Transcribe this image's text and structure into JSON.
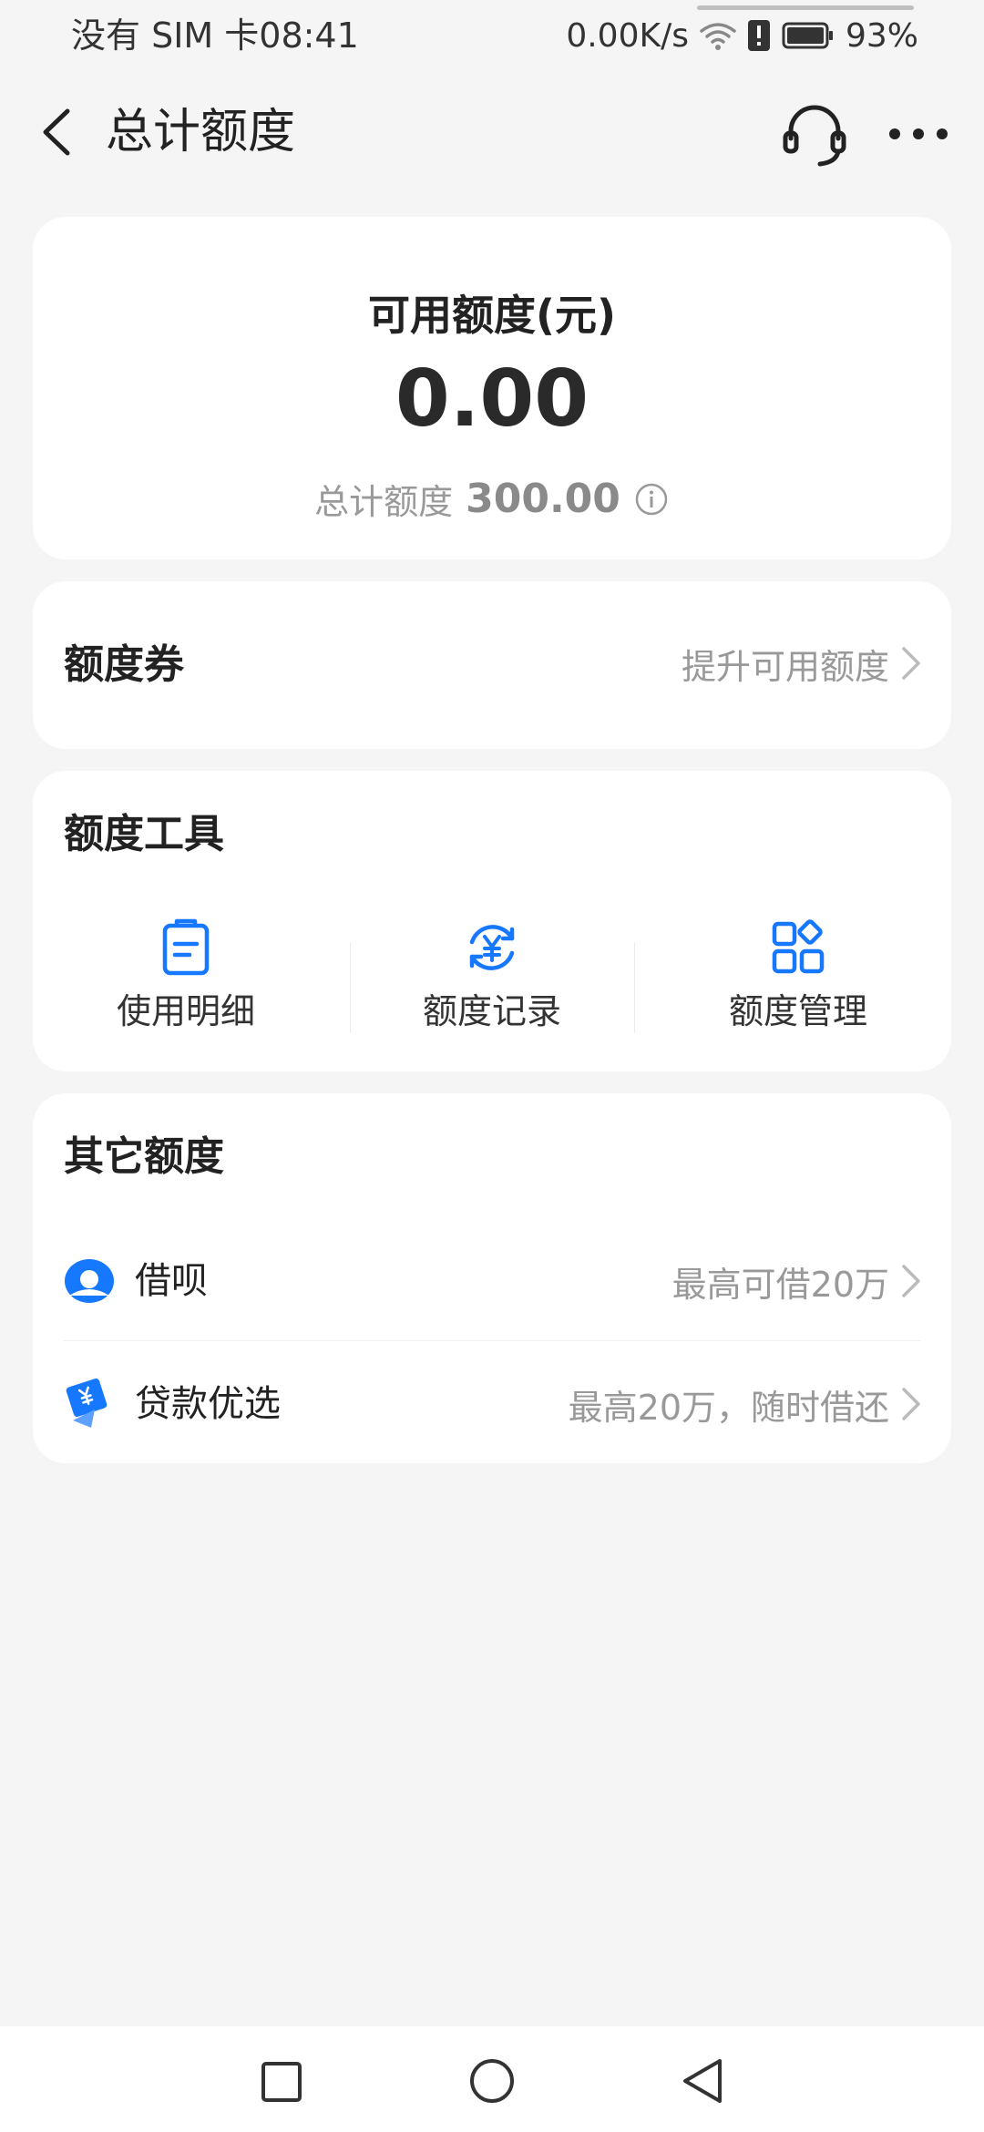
{
  "status_bar": {
    "carrier_time": "没有 SIM 卡08:41",
    "network_speed": "0.00K/s",
    "battery": "93%",
    "icons": [
      "wifi-icon",
      "alert-icon",
      "battery-icon"
    ]
  },
  "header": {
    "title": "总计额度",
    "icons": [
      "back-icon",
      "headset-icon",
      "more-icon"
    ]
  },
  "quota": {
    "label": "可用额度(元)",
    "available": "0.00",
    "total_label": "总计额度",
    "total_value": "300.00"
  },
  "coupon": {
    "title": "额度券",
    "action": "提升可用额度"
  },
  "tools": {
    "title": "额度工具",
    "items": [
      {
        "label": "使用明细",
        "icon": "document-icon"
      },
      {
        "label": "额度记录",
        "icon": "yuan-cycle-icon"
      },
      {
        "label": "额度管理",
        "icon": "grid-icon"
      }
    ]
  },
  "others": {
    "title": "其它额度",
    "items": [
      {
        "label": "借呗",
        "desc": "最高可借20万",
        "icon": "jiebei-icon"
      },
      {
        "label": "贷款优选",
        "desc": "最高20万，随时借还",
        "icon": "loan-icon"
      }
    ]
  },
  "colors": {
    "accent": "#1677ff",
    "background": "#f5f5f5",
    "card": "#ffffff"
  }
}
